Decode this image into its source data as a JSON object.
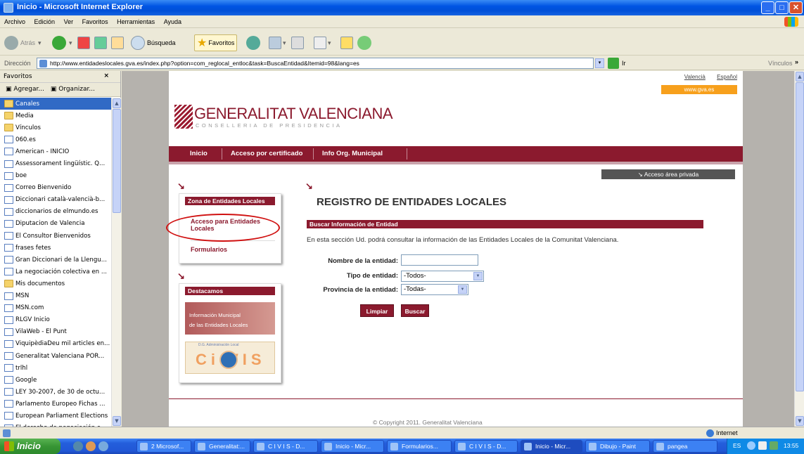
{
  "window": {
    "title": "Inicio - Microsoft Internet Explorer",
    "min": "_",
    "max": "□",
    "close": "✕"
  },
  "menu": [
    "Archivo",
    "Edición",
    "Ver",
    "Favoritos",
    "Herramientas",
    "Ayuda"
  ],
  "toolbar": {
    "back": "Atrás",
    "search": "Búsqueda",
    "favorites": "Favoritos"
  },
  "address": {
    "label": "Dirección",
    "url": "http://www.entidadeslocales.gva.es/index.php?option=com_reglocal_entloc&task=BuscaEntidad&Itemid=98&lang=es",
    "go": "Ir",
    "links": "Vínculos"
  },
  "favorites_pane": {
    "title": "Favoritos",
    "close": "×",
    "add": "Agregar...",
    "organize": "Organizar...",
    "items": [
      {
        "label": "Canales",
        "type": "folder"
      },
      {
        "label": "Media",
        "type": "folder"
      },
      {
        "label": "Vínculos",
        "type": "folder"
      },
      {
        "label": "060.es",
        "type": "page"
      },
      {
        "label": "American - INICIO",
        "type": "page"
      },
      {
        "label": "Assessorament lingüístic. Q...",
        "type": "page"
      },
      {
        "label": "boe",
        "type": "page"
      },
      {
        "label": "Correo  Bienvenido",
        "type": "page"
      },
      {
        "label": "Diccionari català-valencià-b...",
        "type": "page"
      },
      {
        "label": "diccionarios de elmundo.es",
        "type": "page"
      },
      {
        "label": "Diputacion de Valencia",
        "type": "page"
      },
      {
        "label": "El Consultor Bienvenidos",
        "type": "page"
      },
      {
        "label": "frases fetes",
        "type": "page"
      },
      {
        "label": "Gran Diccionari de la Llengu...",
        "type": "page"
      },
      {
        "label": "La negociación colectiva en ...",
        "type": "page"
      },
      {
        "label": "Mis documentos",
        "type": "folder"
      },
      {
        "label": "MSN",
        "type": "page"
      },
      {
        "label": "MSN.com",
        "type": "page"
      },
      {
        "label": "RLGV Inicio",
        "type": "page"
      },
      {
        "label": "VilaWeb - El Punt",
        "type": "page"
      },
      {
        "label": "ViquipèdiaDeu mil articles en...",
        "type": "page"
      },
      {
        "label": "Generalitat Valenciana  POR...",
        "type": "page"
      },
      {
        "label": "trlhl",
        "type": "page"
      },
      {
        "label": "Google",
        "type": "page"
      },
      {
        "label": "LEY 30-2007, de 30 de octu...",
        "type": "page"
      },
      {
        "label": "Parlamento Europeo Fichas ...",
        "type": "page"
      },
      {
        "label": "European Parliament Elections",
        "type": "page"
      },
      {
        "label": "El derecho de negociación c...",
        "type": "page"
      }
    ]
  },
  "page": {
    "lang_valencia": "Valencià",
    "lang_espanol": "Español",
    "gva_tab": "www.gva.es",
    "logo_title": "GENERALITAT VALENCIANA",
    "logo_subtitle": "CONSELLERIA DE PRESIDENCIA",
    "nav": [
      "Inicio",
      "Acceso por certificado",
      "Info Org. Municipal"
    ],
    "private_access": "Acceso área privada",
    "arrow": "↘",
    "sidebar": {
      "zona_head": "Zona de Entidades Locales",
      "acceso_link": "Acceso para Entidades Locales",
      "formularios_link": "Formularios",
      "destacamos_head": "Destacamos",
      "info_banner_line1": "Información Municipal",
      "info_banner_line2": "de las Entidades Locales",
      "civis_top": "D.G. Administración Local",
      "civis_text": "Ci VIS"
    },
    "main": {
      "title": "REGISTRO DE ENTIDADES LOCALES",
      "search_head": "Buscar Información de Entidad",
      "description": "En esta sección Ud. podrá consultar la información de las Entidades Locales de la Comunitat Valenciana.",
      "name_label": "Nombre de la entidad:",
      "name_value": "",
      "type_label": "Tipo de entidad:",
      "type_value": "-Todos-",
      "province_label": "Provincia de la entidad:",
      "province_value": "-Todas-",
      "clear_button": "Limpiar",
      "search_button": "Buscar"
    },
    "copyright": "© Copyright 2011. Generalitat Valenciana"
  },
  "statusbar": {
    "zone": "Internet"
  },
  "taskbar": {
    "start": "Inicio",
    "buttons": [
      "2 Microsof...",
      "Generalitat:...",
      "C I V I S - D...",
      "Inicio - Micr...",
      "Formularios...",
      "C I V I S - D...",
      "Inicio - Micr...",
      "Dibujo - Paint",
      "pangea"
    ],
    "lang": "ES",
    "time": "13:55"
  }
}
